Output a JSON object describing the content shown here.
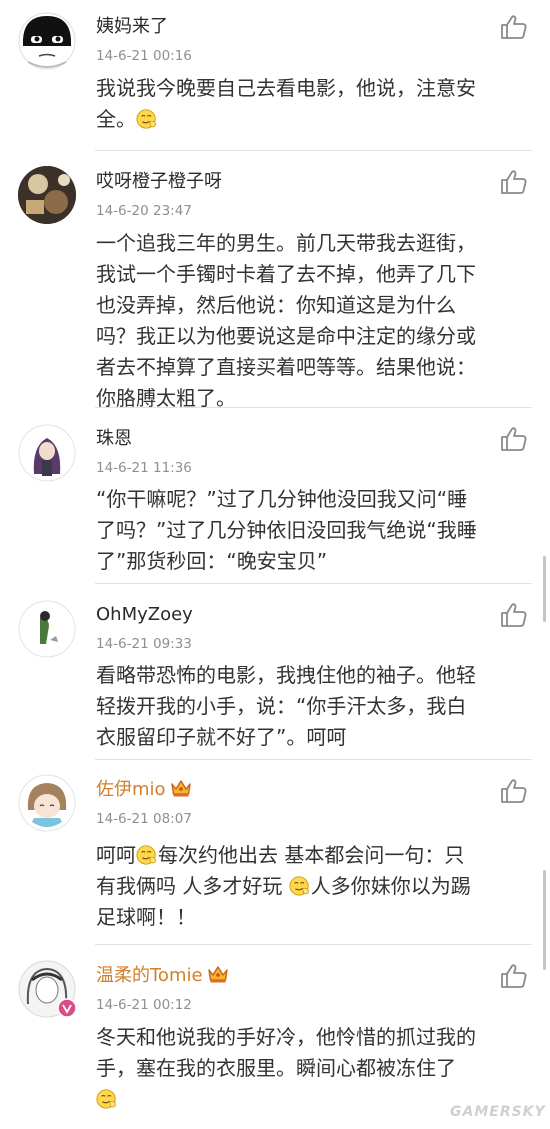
{
  "comments": [
    {
      "user": "姨妈来了",
      "time": "14-6-21 00:16",
      "lines": [
        "我说我今晚要自己去看电影，他说，注意安",
        "全。"
      ]
    },
    {
      "user": "哎呀橙子橙子呀",
      "time": "14-6-20 23:47",
      "lines": [
        "一个追我三年的男生。前几天带我去逛街，",
        "我试一个手镯时卡着了去不掉，他弄了几下",
        "也没弄掉，然后他说：你知道这是为什么",
        "吗？我正以为他要说这是命中注定的缘分或",
        "者去不掉算了直接买着吧等等。结果他说：",
        "你胳膊太粗了。"
      ]
    },
    {
      "user": "珠恩",
      "time": "14-6-21 11:36",
      "lines": [
        "“你干嘛呢？”过了几分钟他没回我又问“睡",
        "了吗？”过了几分钟依旧没回我气绝说“我睡",
        "了”那货秒回：“晚安宝贝”"
      ]
    },
    {
      "user": "OhMyZoey",
      "time": "14-6-21 09:33",
      "lines": [
        "看略带恐怖的电影，我拽住他的袖子。他轻",
        "轻拨开我的小手，说：“你手汗太多，我白",
        "衣服留印子就不好了”。呵呵"
      ]
    },
    {
      "user": "佐伊mio",
      "time": "14-6-21 08:07",
      "lines": [
        "呵呵",
        "每次约他出去 基本都会问一句：只",
        "有我俩吗 人多才好玩 ",
        "人多你妹你以为踢",
        "足球啊！！"
      ]
    },
    {
      "user": "温柔的Tomie",
      "time": "14-6-21 00:12",
      "lines": [
        "冬天和他说我的手好冷，他怜惜的抓过我的",
        "手，塞在我的衣服里。瞬间心都被冻住了"
      ]
    }
  ],
  "watermark": "GAMERSKY",
  "icons": {
    "like": "thumbs-up-icon",
    "crown": "crown-icon",
    "emoji": "smirk-emoji-icon"
  },
  "colors": {
    "vip_name": "#d2802a",
    "time": "#8f8f8f",
    "divider": "#e2e2e2"
  }
}
